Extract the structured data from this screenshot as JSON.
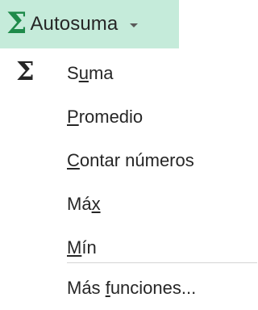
{
  "autosum_button": {
    "label": "Autosuma",
    "icon": "sigma-icon",
    "dropdown_icon": "caret-down-icon",
    "background": "#c5ebda",
    "accent": "#1e8a4a"
  },
  "menu": {
    "items": [
      {
        "before": "S",
        "accel": "u",
        "after": "ma",
        "icon": "sigma-icon"
      },
      {
        "before": "",
        "accel": "P",
        "after": "romedio"
      },
      {
        "before": "",
        "accel": "C",
        "after": "ontar números"
      },
      {
        "before": "Má",
        "accel": "x",
        "after": ""
      },
      {
        "before": "",
        "accel": "M",
        "after": "ín"
      },
      {
        "before": "Más ",
        "accel": "f",
        "after": "unciones..."
      }
    ]
  }
}
